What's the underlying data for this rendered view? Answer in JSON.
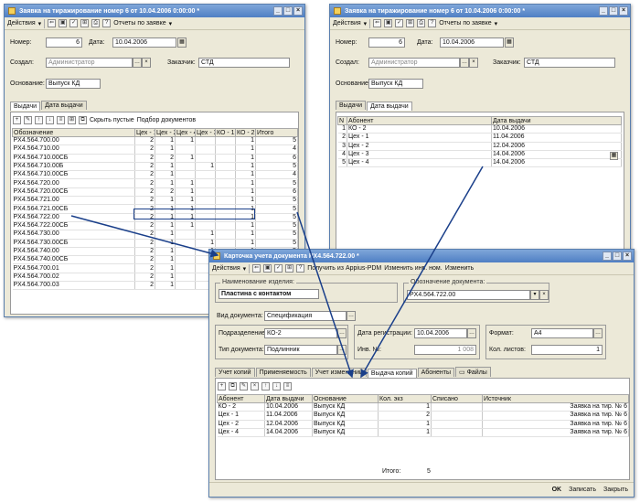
{
  "win1": {
    "title": "Заявка на тиражирование номер 6 от 10.04.2006 0:00:00 *",
    "toolbar": {
      "actions": "Действия",
      "reports": "Отчеты по заявке"
    },
    "nomer_label": "Номер:",
    "nomer_value": "6",
    "data_label": "Дата:",
    "data_value": "10.04.2006",
    "sozdal_label": "Создал:",
    "sozdal_value": "Администратор",
    "zakazchik_label": "Заказчик:",
    "zakazchik_value": "СТД",
    "osnovanie_label": "Основание:",
    "osnovanie_value": "Выпуск КД",
    "tabs": [
      "Выдачи",
      "Дата выдачи"
    ],
    "grid_toolbar": {
      "hide_empty": "Скрыть пустые",
      "select_docs": "Подбор документов"
    },
    "columns": [
      "Обозначение",
      "Цех - 1",
      "Цех - 2",
      "Цех - 4",
      "Цех - 3",
      "КО - 1",
      "КО - 2",
      "Итого"
    ],
    "rows": [
      [
        "PX4.564.700.00",
        "2",
        "1",
        "1",
        "",
        "",
        "1",
        "5"
      ],
      [
        "PX4.564.710.00",
        "2",
        "1",
        "",
        "",
        "",
        "1",
        "4"
      ],
      [
        "PX4.564.710.00СБ",
        "2",
        "2",
        "1",
        "",
        "",
        "1",
        "6"
      ],
      [
        "PX4.564.710.00Б",
        "2",
        "1",
        "",
        "1",
        "",
        "1",
        "5"
      ],
      [
        "PX4.564.710.00СБ",
        "2",
        "1",
        "",
        "",
        "",
        "1",
        "4"
      ],
      [
        "PX4.564.720.00",
        "2",
        "1",
        "1",
        "",
        "",
        "1",
        "5"
      ],
      [
        "PX4.564.720.00СБ",
        "2",
        "2",
        "1",
        "",
        "",
        "1",
        "6"
      ],
      [
        "PX4.564.721.00",
        "2",
        "1",
        "1",
        "",
        "",
        "1",
        "5"
      ],
      [
        "PX4.564.721.00СБ",
        "2",
        "1",
        "1",
        "",
        "",
        "1",
        "5"
      ],
      [
        "PX4.564.722.00",
        "2",
        "1",
        "1",
        "",
        "",
        "1",
        "5"
      ],
      [
        "PX4.564.722.00СБ",
        "2",
        "1",
        "1",
        "",
        "",
        "1",
        "5"
      ],
      [
        "PX4.564.730.00",
        "2",
        "1",
        "",
        "1",
        "",
        "1",
        "5"
      ],
      [
        "PX4.564.730.00СБ",
        "2",
        "1",
        "",
        "1",
        "",
        "1",
        "5"
      ],
      [
        "PX4.564.740.00",
        "2",
        "1",
        "",
        "1",
        "",
        "1",
        "5"
      ],
      [
        "PX4.564.740.00СБ",
        "2",
        "1",
        "",
        "",
        "",
        "1",
        "5"
      ],
      [
        "PX4.564.700.01",
        "2",
        "1",
        "",
        "",
        "",
        "1",
        "5"
      ],
      [
        "PX4.564.700.02",
        "2",
        "1",
        "",
        "",
        "",
        "1",
        "5"
      ],
      [
        "PX4.564.700.03",
        "2",
        "1",
        "",
        "",
        "",
        "1",
        "5"
      ]
    ]
  },
  "win2": {
    "title": "Заявка на тиражирование номер 6 от 10.04.2006 0:00:00 *",
    "toolbar": {
      "actions": "Действия",
      "reports": "Отчеты по заявке"
    },
    "nomer_label": "Номер:",
    "nomer_value": "6",
    "data_label": "Дата:",
    "data_value": "10.04.2006",
    "sozdal_label": "Создал:",
    "sozdal_value": "Администратор",
    "zakazchik_label": "Заказчик:",
    "zakazchik_value": "СТД",
    "osnovanie_label": "Основание:",
    "osnovanie_value": "Выпуск КД",
    "tabs": [
      "Выдачи",
      "Дата выдачи"
    ],
    "columns": [
      "N",
      "Абонент",
      "Дата выдачи"
    ],
    "rows": [
      [
        "1",
        "КО - 2",
        "10.04.2006"
      ],
      [
        "2",
        "Цех - 1",
        "11.04.2006"
      ],
      [
        "3",
        "Цех - 2",
        "12.04.2006"
      ],
      [
        "4",
        "Цех - 3",
        "14.04.2006"
      ],
      [
        "5",
        "Цех - 4",
        "14.04.2006"
      ]
    ]
  },
  "win3": {
    "title": "Карточка учета документа PX4.564.722.00 *",
    "toolbar": {
      "actions": "Действия",
      "get": "Получить из Appius-PDM",
      "change_num": "Изменить инв. ном.",
      "change": "Изменить"
    },
    "name_group": "Наименование изделия:",
    "name_value": "Пластина с контактом",
    "desig_group": "Обозначение документа:",
    "desig_value": "PX4.564.722.00",
    "vid_label": "Вид документа:",
    "vid_value": "Спецификация",
    "podr_label": "Подразделение:",
    "podr_value": "КО-2",
    "tip_label": "Тип документа:",
    "tip_value": "Подлинник",
    "reg_label": "Дата регистрации:",
    "reg_value": "10.04.2006",
    "inv_label": "Инв. №:",
    "inv_value": "1 008",
    "format_label": "Формат:",
    "format_value": "А4",
    "listov_label": "Кол. листов:",
    "listov_value": "1",
    "tabs": [
      "Учет копий",
      "Применяемость",
      "Учет изменений",
      "Выдача копий",
      "Абоненты",
      "Файлы"
    ],
    "columns": [
      "Абонент",
      "Дата выдачи",
      "Основание",
      "Кол. экз",
      "Списано",
      "Источник"
    ],
    "rows": [
      [
        "КО - 2",
        "10.04.2006",
        "Выпуск КД",
        "1",
        "",
        "Заявка на тир. № 6"
      ],
      [
        "Цех - 1",
        "11.04.2006",
        "Выпуск КД",
        "2",
        "",
        "Заявка на тир. № 6"
      ],
      [
        "Цех - 2",
        "12.04.2006",
        "Выпуск КД",
        "1",
        "",
        "Заявка на тир. № 6"
      ],
      [
        "Цех - 4",
        "14.04.2006",
        "Выпуск КД",
        "1",
        "",
        "Заявка на тир. № 6"
      ]
    ],
    "total_label": "Итого:",
    "total_value": "5",
    "buttons": {
      "ok": "OK",
      "save": "Записать",
      "close": "Закрыть"
    }
  },
  "colors": {
    "titlebar": "#4f7fc4",
    "highlight": "#1a3f8a",
    "arrow": "#1a3f8a"
  }
}
